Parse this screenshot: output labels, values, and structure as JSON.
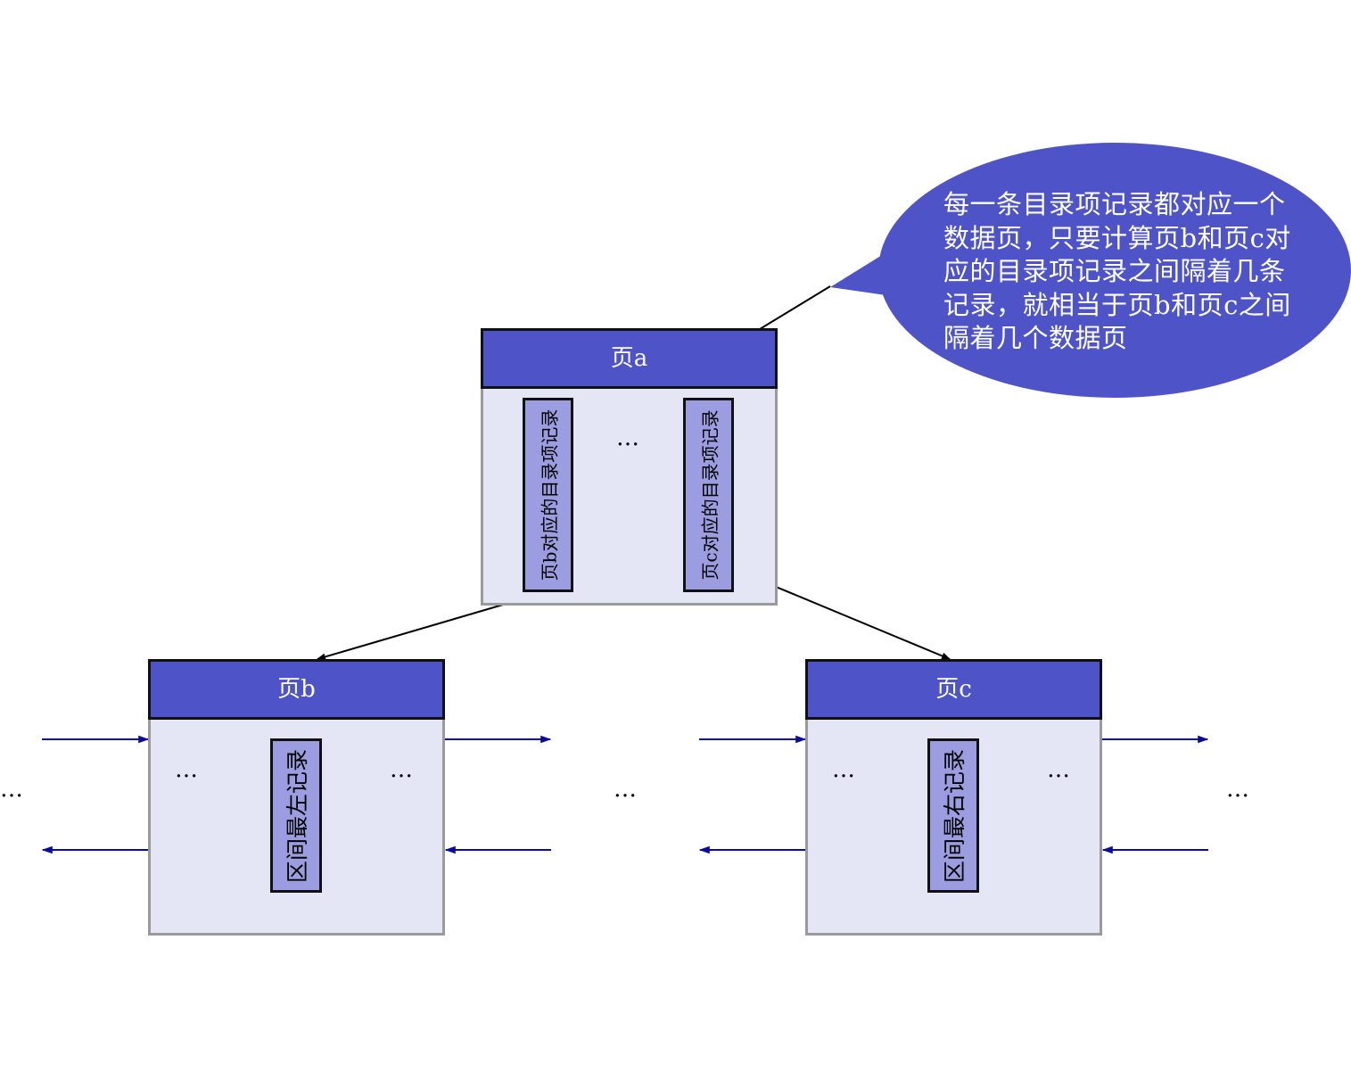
{
  "page_a": {
    "title": "页a",
    "record_b": "页b对应的目录项记录",
    "record_c": "页c对应的目录项记录"
  },
  "page_b": {
    "title": "页b",
    "record": "区间最左记录"
  },
  "page_c": {
    "title": "页c",
    "record": "区间最右记录"
  },
  "ellipsis": "…",
  "callout": {
    "lines": [
      "每一条目录项记录都对应一个",
      "数据页，只要计算页b和页c对",
      "应的目录项记录之间隔着几条",
      "记录，就相当于页b和页c之间",
      "隔着几个数据页"
    ]
  },
  "colors": {
    "header": "#4e54c8",
    "body": "#e4e5f5",
    "record": "#9c9ce0",
    "bubble": "#4e54c8",
    "link_arrow": "#0a0aa0"
  }
}
